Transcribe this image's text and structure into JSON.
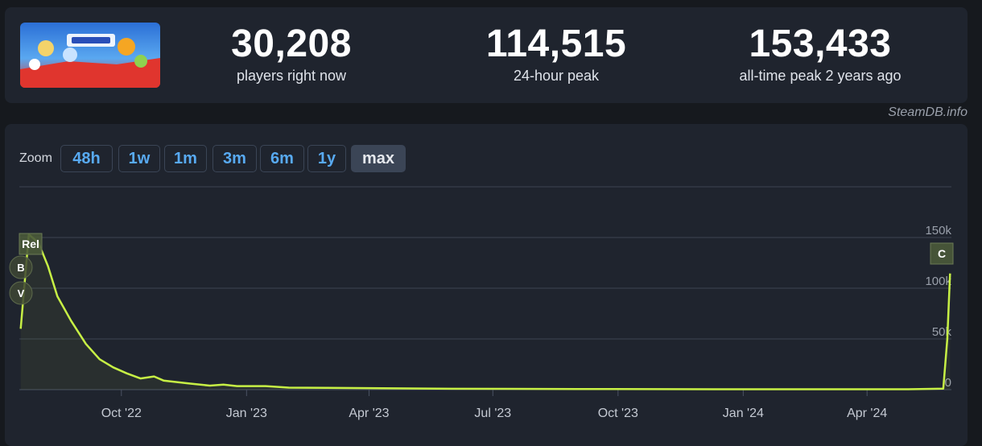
{
  "stats": [
    {
      "value": "30,208",
      "label": "players right now"
    },
    {
      "value": "114,515",
      "label": "24-hour peak"
    },
    {
      "value": "153,433",
      "label": "all-time peak 2 years ago"
    }
  ],
  "credit": "SteamDB.info",
  "zoom": {
    "label": "Zoom",
    "buttons": [
      {
        "label": "48h",
        "active": false
      },
      {
        "label": "1w",
        "active": false
      },
      {
        "label": "1m",
        "active": false
      },
      {
        "label": "3m",
        "active": false
      },
      {
        "label": "6m",
        "active": false
      },
      {
        "label": "1y",
        "active": false
      },
      {
        "label": "max",
        "active": true
      }
    ]
  },
  "colors": {
    "line": "#c7f045",
    "grid": "#3c4352",
    "accent": "#58aaf2"
  },
  "chart_data": {
    "type": "line",
    "series": [
      {
        "values": [
          [
            "2022-07-19",
            60000
          ],
          [
            "2022-07-25",
            153000
          ],
          [
            "2022-08-01",
            145000
          ],
          [
            "2022-08-08",
            122000
          ],
          [
            "2022-08-15",
            92000
          ],
          [
            "2022-08-25",
            68000
          ],
          [
            "2022-09-05",
            45000
          ],
          [
            "2022-09-15",
            30000
          ],
          [
            "2022-09-25",
            22000
          ],
          [
            "2022-10-05",
            16000
          ],
          [
            "2022-10-15",
            11000
          ],
          [
            "2022-10-25",
            13000
          ],
          [
            "2022-11-01",
            9000
          ],
          [
            "2022-11-20",
            6000
          ],
          [
            "2022-12-05",
            4000
          ],
          [
            "2022-12-15",
            5000
          ],
          [
            "2022-12-25",
            3500
          ],
          [
            "2023-01-15",
            3500
          ],
          [
            "2023-02-01",
            2000
          ],
          [
            "2023-03-01",
            1800
          ],
          [
            "2023-04-01",
            1500
          ],
          [
            "2023-06-01",
            900
          ],
          [
            "2023-09-01",
            600
          ],
          [
            "2024-01-01",
            400
          ],
          [
            "2024-05-01",
            400
          ],
          [
            "2024-05-27",
            1000
          ],
          [
            "2024-05-30",
            50000
          ],
          [
            "2024-06-01",
            114515
          ]
        ]
      }
    ],
    "x_ticks": [
      "Oct '22",
      "Jan '23",
      "Apr '23",
      "Jul '23",
      "Oct '23",
      "Jan '24",
      "Apr '24"
    ],
    "x_tick_dates": [
      "2022-10-01",
      "2023-01-01",
      "2023-04-01",
      "2023-07-01",
      "2023-10-01",
      "2024-01-01",
      "2024-04-01"
    ],
    "xlim": [
      "2022-07-18",
      "2024-06-02"
    ],
    "y_ticks": [
      "0",
      "50k",
      "100k",
      "150k"
    ],
    "y_tick_values": [
      0,
      50000,
      100000,
      150000
    ],
    "ylim": [
      0,
      200000
    ],
    "grid": true,
    "annotations": [
      {
        "label": "Rel",
        "date": "2022-07-25"
      },
      {
        "label": "B",
        "date": "2022-07-19"
      },
      {
        "label": "V",
        "date": "2022-07-19"
      },
      {
        "label": "C",
        "date": "2024-06-01"
      }
    ]
  }
}
